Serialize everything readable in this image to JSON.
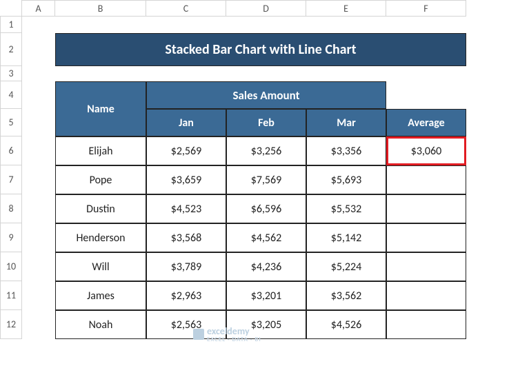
{
  "columns": [
    "A",
    "B",
    "C",
    "D",
    "E",
    "F"
  ],
  "rows": [
    "1",
    "2",
    "3",
    "4",
    "5",
    "6",
    "7",
    "8",
    "9",
    "10",
    "11",
    "12"
  ],
  "title": "Stacked Bar Chart with Line Chart",
  "sales_header": "Sales Amount",
  "headers": {
    "name": "Name",
    "months": [
      "Jan",
      "Feb",
      "Mar"
    ],
    "avg": "Average"
  },
  "data_rows": [
    {
      "name": "Elijah",
      "vals": [
        "$2,569",
        "$3,256",
        "$3,356"
      ],
      "avg": "$3,060"
    },
    {
      "name": "Pope",
      "vals": [
        "$3,659",
        "$7,569",
        "$5,693"
      ],
      "avg": ""
    },
    {
      "name": "Dustin",
      "vals": [
        "$4,523",
        "$6,596",
        "$5,532"
      ],
      "avg": ""
    },
    {
      "name": "Henderson",
      "vals": [
        "$3,568",
        "$4,562",
        "$5,142"
      ],
      "avg": ""
    },
    {
      "name": "Will",
      "vals": [
        "$3,789",
        "$4,236",
        "$5,224"
      ],
      "avg": ""
    },
    {
      "name": "James",
      "vals": [
        "$2,963",
        "$3,201",
        "$3,562"
      ],
      "avg": ""
    },
    {
      "name": "Noah",
      "vals": [
        "$2,563",
        "$3,205",
        "$4,526"
      ],
      "avg": ""
    }
  ],
  "watermark": {
    "main": "exceldemy",
    "sub": "EXCEL · DATA · BI"
  },
  "chart_data": {
    "type": "bar",
    "title": "Stacked Bar Chart with Line Chart",
    "categories": [
      "Elijah",
      "Pope",
      "Dustin",
      "Henderson",
      "Will",
      "James",
      "Noah"
    ],
    "series": [
      {
        "name": "Jan",
        "values": [
          2569,
          3659,
          4523,
          3568,
          3789,
          2963,
          2563
        ]
      },
      {
        "name": "Feb",
        "values": [
          3256,
          7569,
          6596,
          4562,
          4236,
          3201,
          3205
        ]
      },
      {
        "name": "Mar",
        "values": [
          3356,
          5693,
          5532,
          5142,
          5224,
          3562,
          4526
        ]
      },
      {
        "name": "Average",
        "values": [
          3060,
          null,
          null,
          null,
          null,
          null,
          null
        ]
      }
    ],
    "xlabel": "Name",
    "ylabel": "Sales Amount"
  }
}
